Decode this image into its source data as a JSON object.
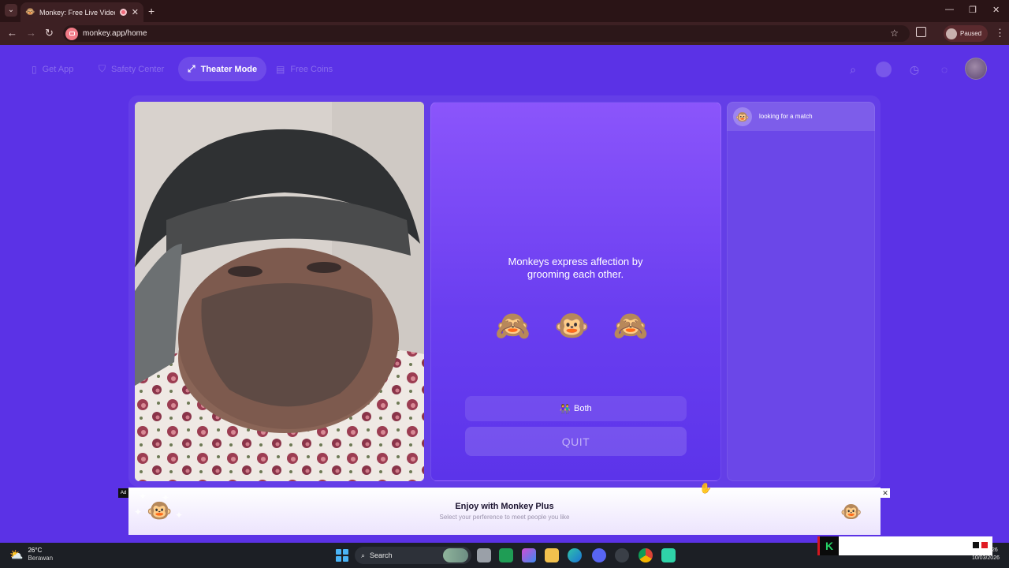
{
  "browser": {
    "tab_title": "Monkey: Free Live Video Ch",
    "url": "monkey.app/home",
    "profile_status": "Paused",
    "icons": {
      "back": "back-arrow-icon",
      "forward": "forward-arrow-icon",
      "reload": "reload-icon",
      "bookmark": "star-icon",
      "extensions": "extensions-icon",
      "menu": "kebab-menu-icon"
    }
  },
  "header": {
    "nav": [
      {
        "label": "Get App",
        "icon": "phone-icon"
      },
      {
        "label": "Safety Center",
        "icon": "shield-icon"
      },
      {
        "label": "Theater Mode",
        "icon": "expand-icon",
        "active": true
      },
      {
        "label": "Free Coins",
        "icon": "coins-icon"
      }
    ],
    "right_icons": [
      "search-icon",
      "coin-icon",
      "history-icon",
      "chat-icon",
      "avatar"
    ]
  },
  "center": {
    "emojis": "🙈 🐵 🙈",
    "fact": "Monkeys express affection by grooming each other.",
    "both_icon": "👫",
    "both_label": "Both",
    "quit_label": "QUIT"
  },
  "chat": {
    "status": "looking for a match"
  },
  "ad": {
    "tag": "Ad",
    "title": "Enjoy with Monkey Plus",
    "subtitle": "Select your perference to meet people you like",
    "close": "✕"
  },
  "taskbar": {
    "weather_temp": "26°C",
    "weather_desc": "Berawan",
    "search_label": "Search",
    "date": "10/03/2026",
    "clock_partial": "26"
  },
  "colors": {
    "page_bg": "#5b32e6",
    "panel_gradient_top": "#8b55fb",
    "browser_frame": "#3d2023",
    "ad_bg": "#ece4fd"
  }
}
